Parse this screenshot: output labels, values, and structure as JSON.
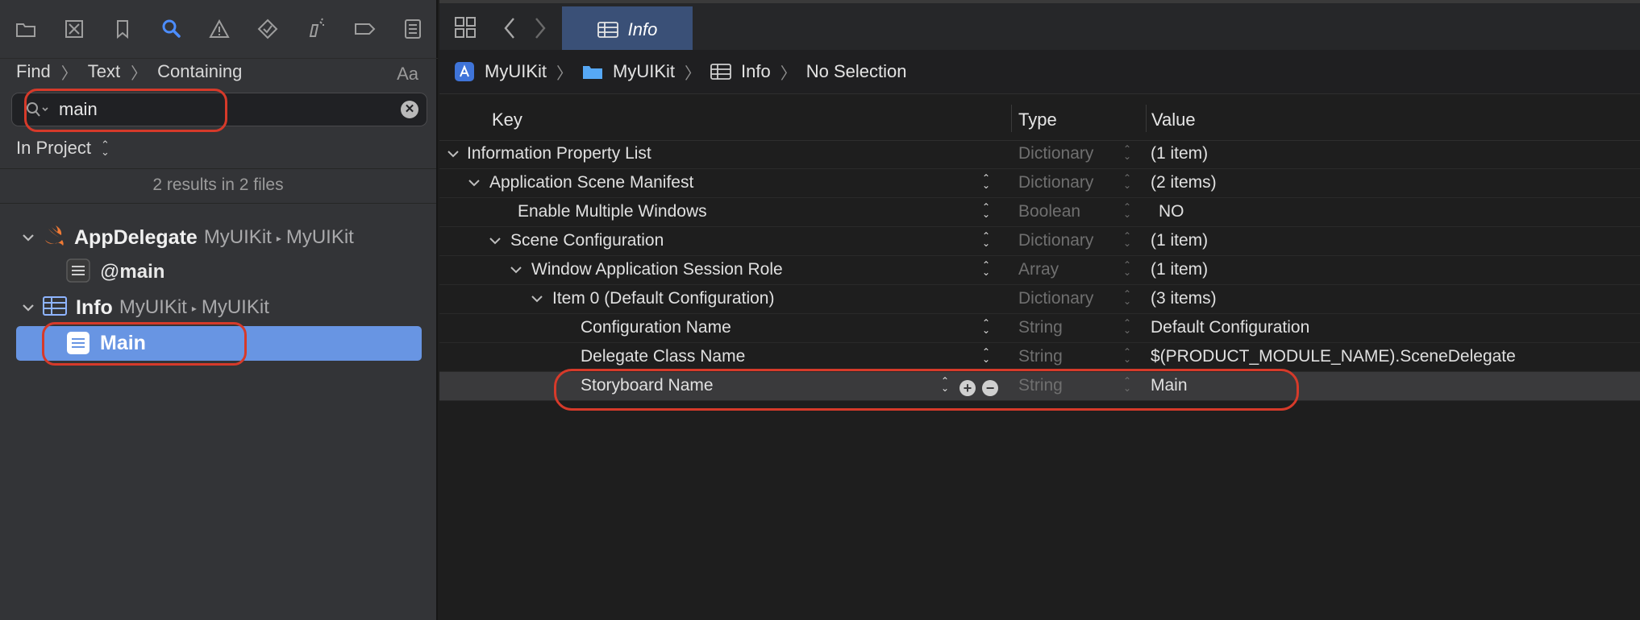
{
  "navigator": {
    "toolbar_icons": [
      "folder-icon",
      "source-control-icon",
      "bookmark-icon",
      "search-icon",
      "warning-icon",
      "test-icon",
      "debug-icon",
      "breakpoint-icon",
      "report-icon"
    ],
    "find_mode": "Find",
    "find_type": "Text",
    "find_match": "Containing",
    "case_toggle": "Aa",
    "search_value": "main",
    "scope": "In Project",
    "results_summary": "2 results in 2 files",
    "results": [
      {
        "file": "AppDelegate",
        "path_a": "MyUIKit",
        "path_b": "MyUIKit",
        "icon": "swift-icon",
        "match": "main",
        "match_prefix": "@"
      },
      {
        "file": "Info",
        "path_a": "MyUIKit",
        "path_b": "MyUIKit",
        "icon": "plist-icon",
        "match": "Main"
      }
    ],
    "accent_color": "#6895e3"
  },
  "editor": {
    "tab_title": "Info",
    "jumpbar": [
      "MyUIKit",
      "MyUIKit",
      "Info",
      "No Selection"
    ],
    "columns": {
      "key": "Key",
      "type": "Type",
      "value": "Value"
    },
    "rows": [
      {
        "key": "Information Property List",
        "type": "Dictionary",
        "value": "(1 item)"
      },
      {
        "key": "Application Scene Manifest",
        "type": "Dictionary",
        "value": "(2 items)"
      },
      {
        "key": "Enable Multiple Windows",
        "type": "Boolean",
        "value": "NO"
      },
      {
        "key": "Scene Configuration",
        "type": "Dictionary",
        "value": "(1 item)"
      },
      {
        "key": "Window Application Session Role",
        "type": "Array",
        "value": "(1 item)"
      },
      {
        "key": "Item 0 (Default Configuration)",
        "type": "Dictionary",
        "value": "(3 items)"
      },
      {
        "key": "Configuration Name",
        "type": "String",
        "value": "Default Configuration"
      },
      {
        "key": "Delegate Class Name",
        "type": "String",
        "value": "$(PRODUCT_MODULE_NAME).SceneDelegate"
      },
      {
        "key": "Storyboard Name",
        "type": "String",
        "value": "Main"
      }
    ]
  },
  "highlight_color": "#d63a2a"
}
